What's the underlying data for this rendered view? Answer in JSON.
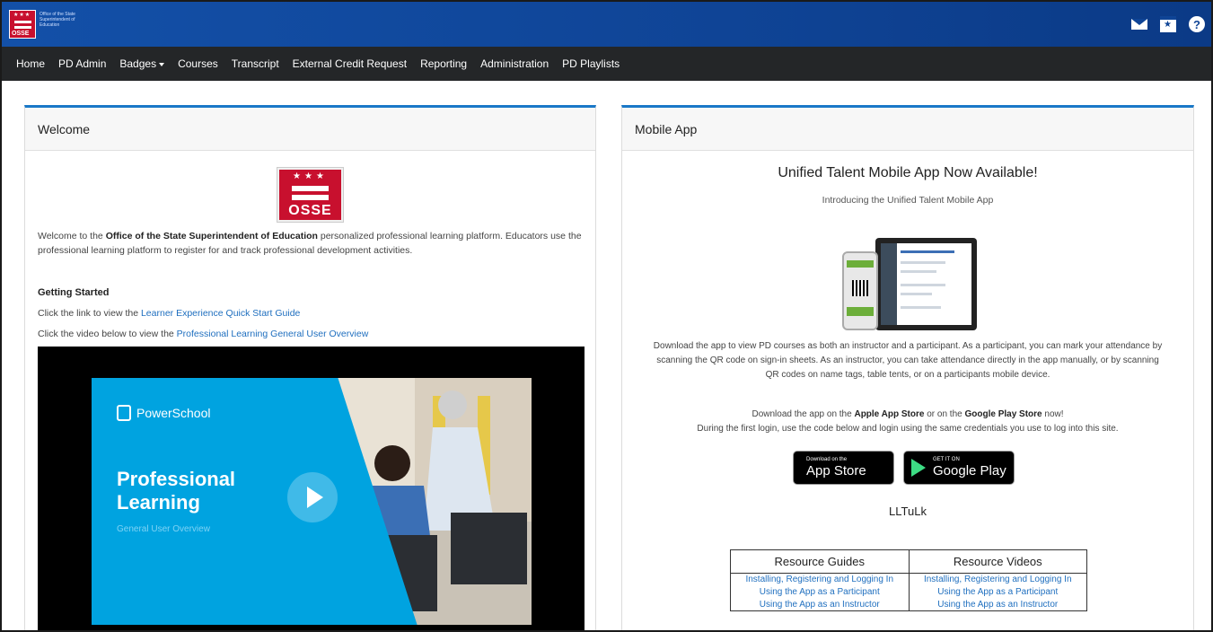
{
  "header": {
    "logo_text": "OSSE",
    "logo_caption": "Office of the State Superintendent of Education",
    "icons": [
      "mail-icon",
      "calendar-icon",
      "help-icon"
    ]
  },
  "nav": {
    "items": [
      {
        "label": "Home",
        "dropdown": false
      },
      {
        "label": "PD Admin",
        "dropdown": false
      },
      {
        "label": "Badges",
        "dropdown": true
      },
      {
        "label": "Courses",
        "dropdown": false
      },
      {
        "label": "Transcript",
        "dropdown": false
      },
      {
        "label": "External Credit Request",
        "dropdown": false
      },
      {
        "label": "Reporting",
        "dropdown": false
      },
      {
        "label": "Administration",
        "dropdown": false
      },
      {
        "label": "PD Playlists",
        "dropdown": false
      }
    ]
  },
  "welcome": {
    "title": "Welcome",
    "logo_text": "OSSE",
    "intro_prefix": "Welcome to the ",
    "intro_bold": "Office of the State Superintendent of Education",
    "intro_suffix": " personalized professional learning platform. Educators use the professional learning platform to register for and track professional development activities.",
    "getting_started": "Getting Started",
    "line1_prefix": "Click the link to view the ",
    "line1_link": "Learner Experience Quick Start Guide",
    "line2_prefix": "Click the video below to view the ",
    "line2_link": "Professional Learning General User Overview",
    "video": {
      "brand": "PowerSchool",
      "title_line1": "Professional",
      "title_line2": "Learning",
      "subtitle": "General User Overview"
    }
  },
  "mobile": {
    "title": "Mobile App",
    "headline": "Unified Talent Mobile App Now Available!",
    "subheadline": "Introducing the Unified Talent Mobile App",
    "body": "Download the app to view PD courses as both an instructor and a participant. As a participant, you can mark your attendance by scanning the QR code on sign-in sheets. As an instructor, you can take attendance directly in the app manually, or by scanning QR codes on name tags, table tents, or on a participants mobile device.",
    "store_prefix": "Download the app on the ",
    "store_apple": "Apple App Store",
    "store_mid": " or on the ",
    "store_google": "Google Play Store",
    "store_suffix": " now!",
    "login_line": "During the first login, use the code below and login using the same credentials you use to log into this site.",
    "apple_badge_small": "Download on the",
    "apple_badge_big": "App Store",
    "google_badge_small": "GET IT ON",
    "google_badge_big": "Google Play",
    "code": "LLTuLk",
    "resources": {
      "headers": [
        "Resource Guides",
        "Resource Videos"
      ],
      "rows": [
        [
          "Installing, Registering and Logging In",
          "Installing, Registering and Logging In"
        ],
        [
          "Using the App as a Participant",
          "Using the App as a Participant"
        ],
        [
          "Using the App as an Instructor",
          "Using the App as an Instructor"
        ]
      ]
    }
  },
  "colors": {
    "header_blue": "#0f4496",
    "nav_dark": "#242628",
    "panel_accent": "#1a78c8",
    "link": "#1f6fbf",
    "osse_red": "#c8102e"
  }
}
